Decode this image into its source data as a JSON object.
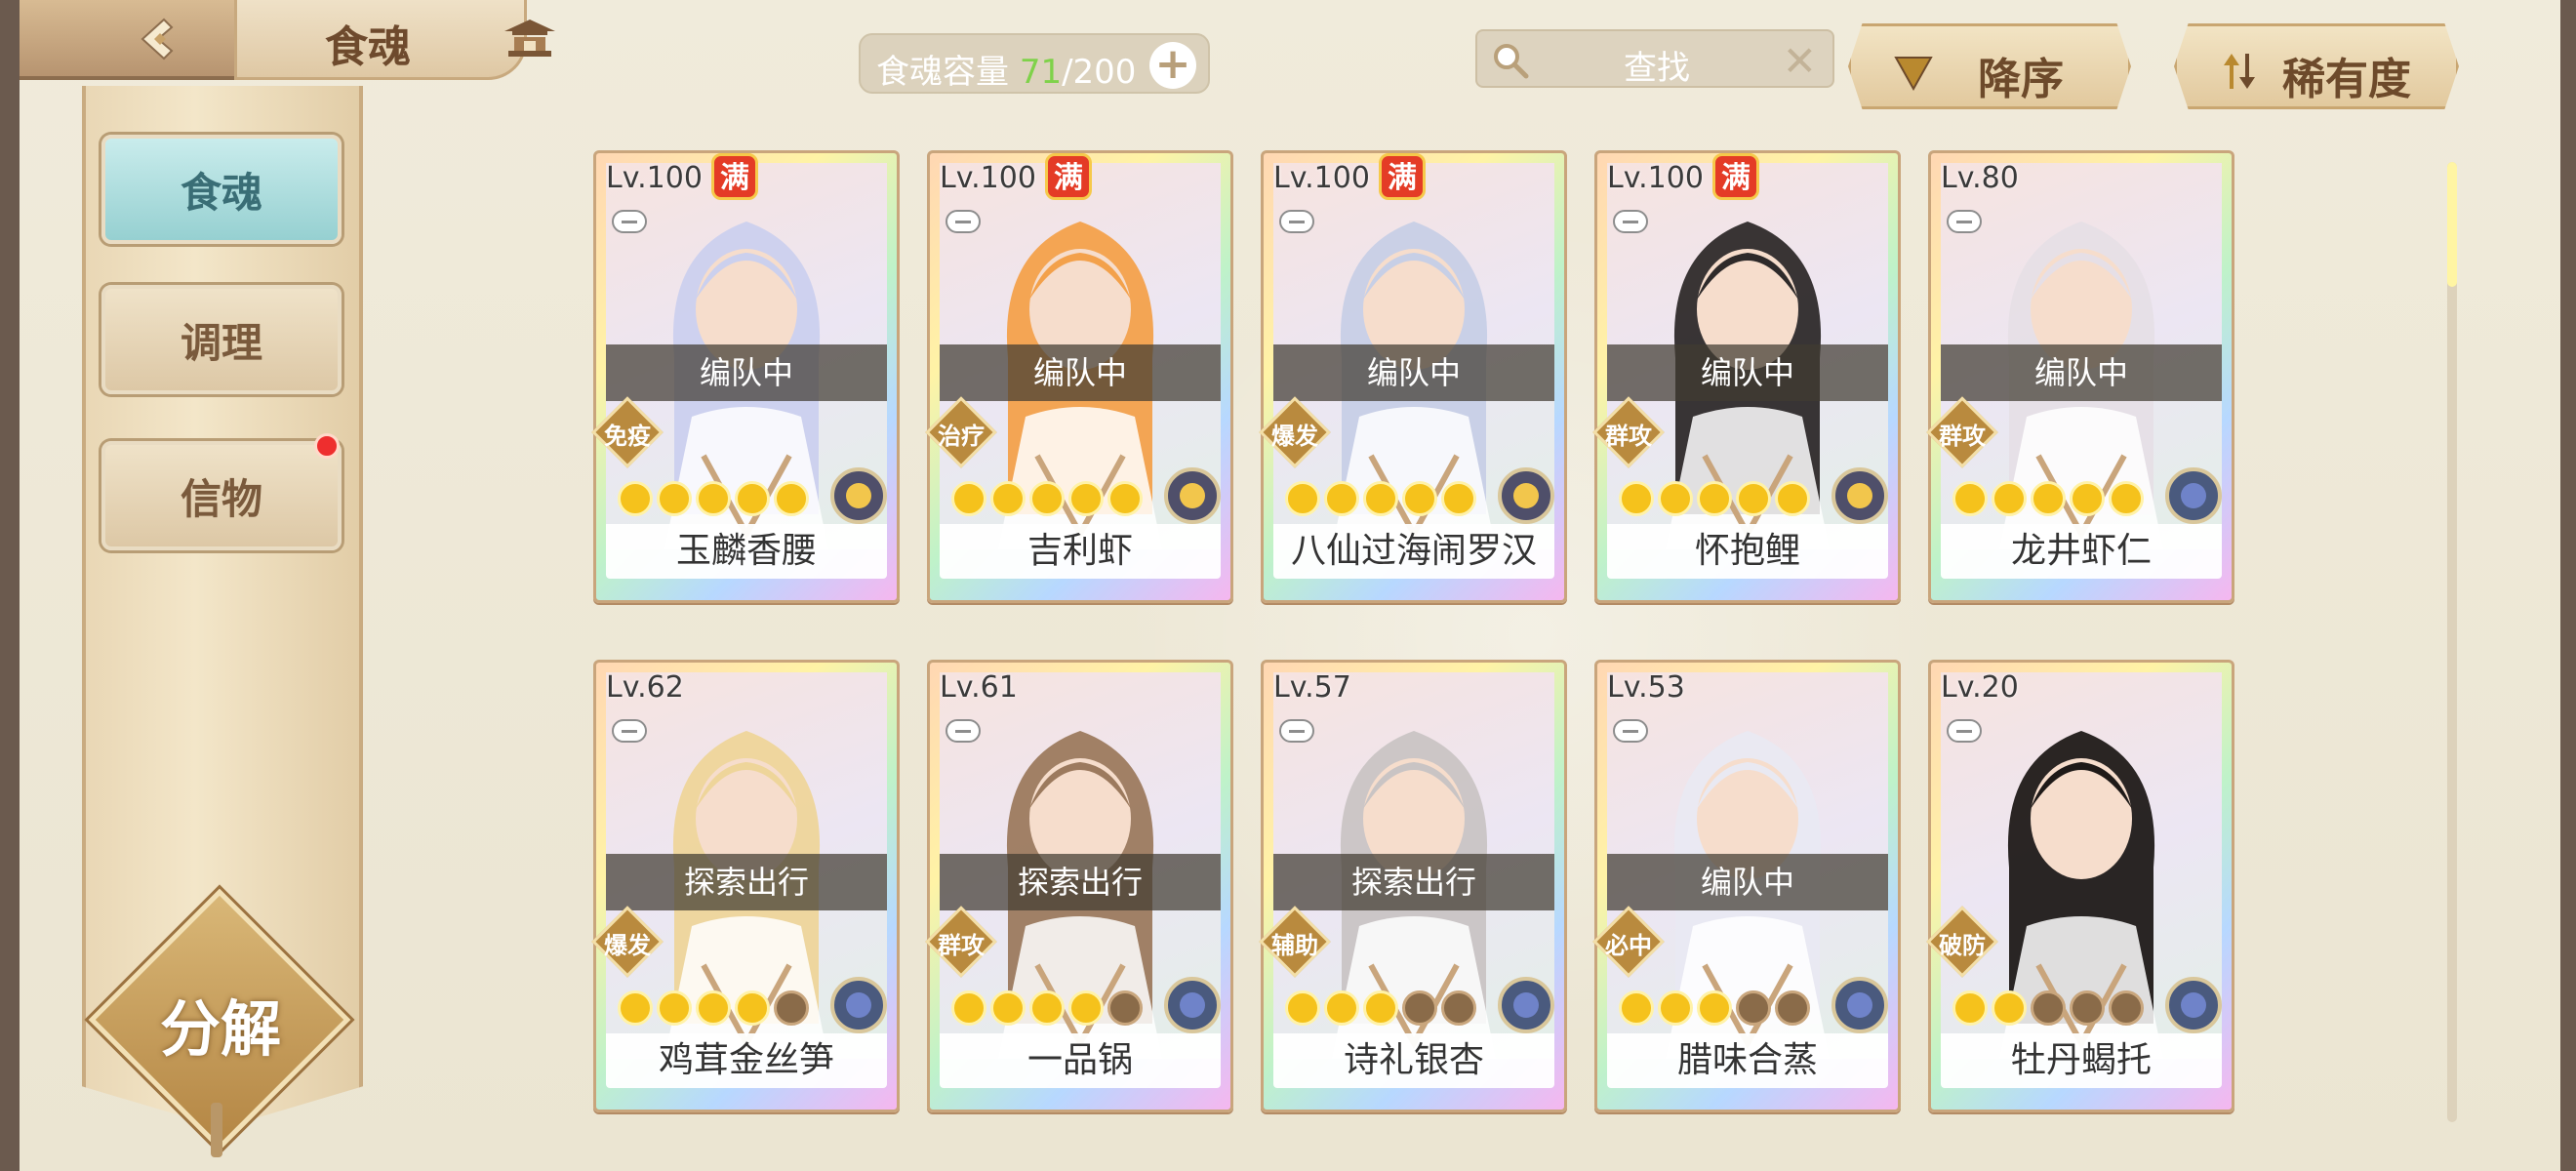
{
  "header": {
    "title": "食魂",
    "capacity_label": "食魂容量",
    "capacity_current": "71",
    "capacity_max": "/200",
    "search_placeholder": "查找",
    "sort_desc_label": "降序",
    "sort_rarity_label": "稀有度"
  },
  "sidebar": {
    "tabs": [
      {
        "label": "食魂",
        "active": true
      },
      {
        "label": "调理",
        "active": false
      },
      {
        "label": "信物",
        "active": false,
        "badge": true
      }
    ],
    "decompose_label": "分解"
  },
  "colors": {
    "accent_teal": "#96d0d1",
    "gold": "#b98a3e",
    "badge_red": "#ee2e2e",
    "capacity_green": "#7fd24a"
  },
  "cards": [
    {
      "level": "Lv.100",
      "full": "满",
      "status": "编队中",
      "role": "免疫",
      "name": "玉麟香腰",
      "stars_on": 5,
      "emblem": "gold",
      "hair": "#cbd0ee"
    },
    {
      "level": "Lv.100",
      "full": "满",
      "status": "编队中",
      "role": "治疗",
      "name": "吉利虾",
      "stars_on": 5,
      "emblem": "gold",
      "hair": "#f3a14b"
    },
    {
      "level": "Lv.100",
      "full": "满",
      "status": "编队中",
      "role": "爆发",
      "name": "八仙过海闹罗汉",
      "stars_on": 5,
      "emblem": "gold",
      "hair": "#c7cfe6"
    },
    {
      "level": "Lv.100",
      "full": "满",
      "status": "编队中",
      "role": "群攻",
      "name": "怀抱鲤",
      "stars_on": 5,
      "emblem": "gold",
      "hair": "#2e2a2a"
    },
    {
      "level": "Lv.80",
      "full": "",
      "status": "编队中",
      "role": "群攻",
      "name": "龙井虾仁",
      "stars_on": 5,
      "emblem": "blue",
      "hair": "#e6dfe6"
    },
    {
      "level": "Lv.62",
      "full": "",
      "status": "探索出行",
      "role": "爆发",
      "name": "鸡茸金丝笋",
      "stars_on": 4,
      "emblem": "blue",
      "hair": "#eed59a"
    },
    {
      "level": "Lv.61",
      "full": "",
      "status": "探索出行",
      "role": "群攻",
      "name": "一品锅",
      "stars_on": 4,
      "emblem": "blue",
      "hair": "#9c7a5e"
    },
    {
      "level": "Lv.57",
      "full": "",
      "status": "探索出行",
      "role": "辅助",
      "name": "诗礼银杏",
      "stars_on": 3,
      "emblem": "blue",
      "hair": "#c9c4c4"
    },
    {
      "level": "Lv.53",
      "full": "",
      "status": "编队中",
      "role": "必中",
      "name": "腊味合蒸",
      "stars_on": 3,
      "emblem": "blue",
      "hair": "#e9e9f2"
    },
    {
      "level": "Lv.20",
      "full": "",
      "status": "",
      "role": "破防",
      "name": "牡丹蝎托",
      "stars_on": 2,
      "emblem": "blue",
      "hair": "#1f1a18"
    }
  ]
}
